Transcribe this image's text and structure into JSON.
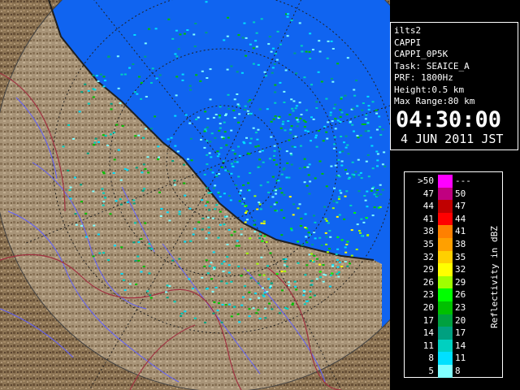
{
  "info": {
    "site": "ilts2",
    "product": "CAPPI",
    "product_name": "CAPPI_0P5K",
    "task": "Task: SEAICE_A",
    "prf": "PRF: 1800Hz",
    "height": "Height:0.5 km",
    "max_range": "Max Range:80 km",
    "time": "04:30:00",
    "date": "4 JUN 2011 JST"
  },
  "legend": {
    "unit_label": "Reflectivity in dBZ",
    "rows": [
      {
        "lo": ">50",
        "hi": "---",
        "color": "#ff00ff"
      },
      {
        "lo": "47",
        "hi": "50",
        "color": "#c00080"
      },
      {
        "lo": "44",
        "hi": "47",
        "color": "#c00000"
      },
      {
        "lo": "41",
        "hi": "44",
        "color": "#ff0000"
      },
      {
        "lo": "38",
        "hi": "41",
        "color": "#ff8000"
      },
      {
        "lo": "35",
        "hi": "38",
        "color": "#ffa000"
      },
      {
        "lo": "32",
        "hi": "35",
        "color": "#ffd000"
      },
      {
        "lo": "29",
        "hi": "32",
        "color": "#ffff00"
      },
      {
        "lo": "26",
        "hi": "29",
        "color": "#a0ff00"
      },
      {
        "lo": "23",
        "hi": "26",
        "color": "#00ff00"
      },
      {
        "lo": "20",
        "hi": "23",
        "color": "#00c000"
      },
      {
        "lo": "17",
        "hi": "20",
        "color": "#00a040"
      },
      {
        "lo": "14",
        "hi": "17",
        "color": "#00a080"
      },
      {
        "lo": "11",
        "hi": "14",
        "color": "#00d0c0"
      },
      {
        "lo": "8",
        "hi": "11",
        "color": "#00e0ff"
      },
      {
        "lo": "5",
        "hi": "8",
        "color": "#80ffff"
      }
    ]
  },
  "colors": {
    "sea": "#1064f0",
    "land": "#8a7050",
    "outside": "#000000",
    "range_ring": "#202020",
    "river": "#6060ff",
    "border": "#a03040"
  }
}
